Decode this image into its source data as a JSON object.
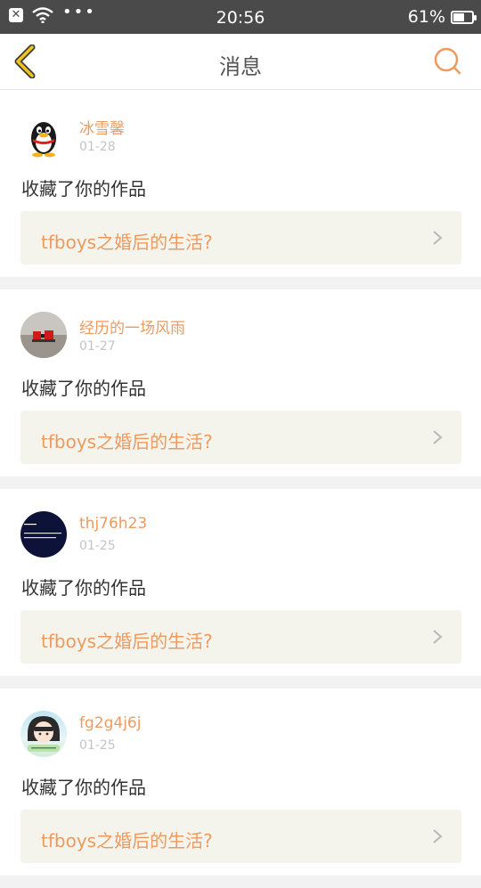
{
  "status_bar": {
    "time": "20:56",
    "battery_percent": "61%",
    "battery_level": 0.61,
    "icons": [
      "close-notification-icon",
      "wifi-icon",
      "more-dots-icon",
      "battery-icon"
    ]
  },
  "nav": {
    "title": "消息",
    "back_icon": "chevron-left-icon",
    "search_icon": "search-icon",
    "accent_color": "#ee9a5f",
    "back_color": "#f0c419"
  },
  "messages": [
    {
      "username": "冰雪馨",
      "date": "01-28",
      "action": "收藏了你的作品",
      "work_title": "tfboys之婚后的生活?",
      "avatar": "qq-penguin-avatar"
    },
    {
      "username": "经历的一场风雨",
      "date": "01-27",
      "action": "收藏了你的作品",
      "work_title": "tfboys之婚后的生活?",
      "avatar": "photo-avatar"
    },
    {
      "username": "thj76h23",
      "date": "01-25",
      "action": "收藏了你的作品",
      "work_title": "tfboys之婚后的生活?",
      "avatar": "dark-text-avatar"
    },
    {
      "username": "fg2g4j6j",
      "date": "01-25",
      "action": "收藏了你的作品",
      "work_title": "tfboys之婚后的生活?",
      "avatar": "girl-illustration-avatar"
    }
  ]
}
